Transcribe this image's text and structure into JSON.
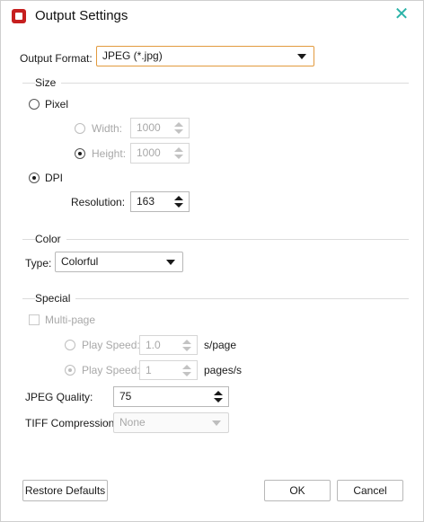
{
  "window": {
    "title": "Output Settings"
  },
  "output_format": {
    "label": "Output Format:",
    "value": "JPEG (*.jpg)"
  },
  "size": {
    "section": "Size",
    "pixel_label": "Pixel",
    "width_label": "Width:",
    "width_value": "1000",
    "height_label": "Height:",
    "height_value": "1000",
    "dpi_label": "DPI",
    "resolution_label": "Resolution:",
    "resolution_value": "163"
  },
  "color": {
    "section": "Color",
    "type_label": "Type:",
    "type_value": "Colorful"
  },
  "special": {
    "section": "Special",
    "multipage_label": "Multi-page",
    "play_speed_label_1": "Play Speed:",
    "play_speed_value_1": "1.0",
    "play_speed_unit_1": "s/page",
    "play_speed_label_2": "Play Speed:",
    "play_speed_value_2": "1",
    "play_speed_unit_2": "pages/s",
    "jpeg_quality_label": "JPEG Quality:",
    "jpeg_quality_value": "75",
    "tiff_label": "TIFF Compression:",
    "tiff_value": "None"
  },
  "buttons": {
    "restore": "Restore Defaults",
    "ok": "OK",
    "cancel": "Cancel"
  },
  "colors": {
    "accent_focus": "#e29a3e",
    "close_icon": "#2bb3a8",
    "app_icon": "#c61f1f"
  }
}
